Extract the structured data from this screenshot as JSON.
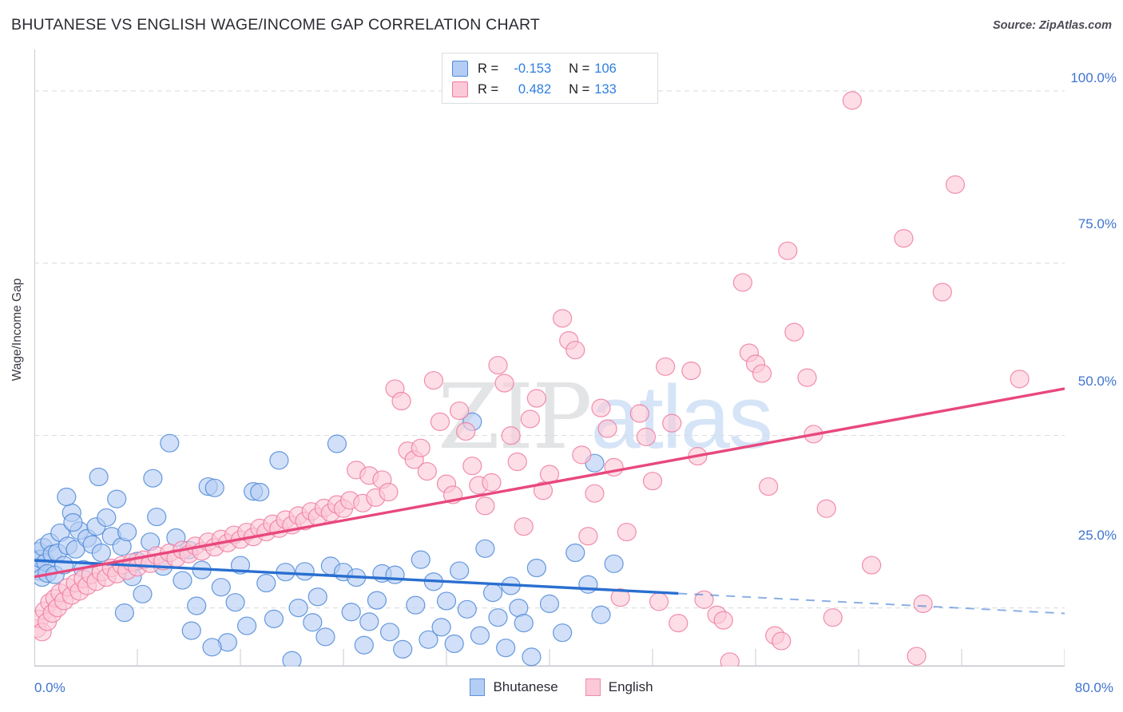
{
  "header": {
    "title": "BHUTANESE VS ENGLISH WAGE/INCOME GAP CORRELATION CHART",
    "source": "Source: ZipAtlas.com"
  },
  "watermark": {
    "part1": "ZIP",
    "part2": "atlas"
  },
  "stats_legend": {
    "rows": [
      {
        "series": "Bhutanese",
        "color": "#b4cdf4",
        "r_label": "R =",
        "r_value": "-0.153",
        "n_label": "N =",
        "n_value": "106"
      },
      {
        "series": "English",
        "color": "#fbc9d8",
        "r_label": "R =",
        "r_value": "0.482",
        "n_label": "N =",
        "n_value": "133"
      }
    ]
  },
  "bottom_legend": {
    "items": [
      {
        "label": "Bhutanese",
        "color": "#b4cdf4"
      },
      {
        "label": "English",
        "color": "#fbc9d8"
      }
    ]
  },
  "chart_data": {
    "type": "scatter",
    "title": "BHUTANESE VS ENGLISH WAGE/INCOME GAP CORRELATION CHART",
    "xlabel": "",
    "ylabel": "Wage/Income Gap",
    "xlim": [
      0,
      80
    ],
    "ylim": [
      16.5,
      106.0
    ],
    "xticks": [
      0,
      80
    ],
    "xticklabels": [
      "0.0%",
      "80.0%"
    ],
    "yticks": [
      25,
      50,
      75,
      100
    ],
    "yticklabels": [
      "25.0%",
      "50.0%",
      "75.0%",
      "100.0%"
    ],
    "grid": "horizontal-dashed",
    "legend_position": "bottom-center",
    "series": [
      {
        "name": "Bhutanese",
        "color": "#b4cdf4",
        "stroke": "#4d88d8",
        "r": -0.153,
        "n": 106,
        "trend": {
          "x0": 0.0,
          "y0": 31.9,
          "x1": 50.0,
          "y1": 27.1,
          "x_solid_end": 50.0,
          "x_dashed_end": 80.0,
          "y_dashed_end": 24.2
        },
        "points": [
          [
            0.2,
            31.0
          ],
          [
            0.3,
            33.2
          ],
          [
            0.4,
            30.3
          ],
          [
            0.5,
            32.1
          ],
          [
            0.6,
            29.4
          ],
          [
            0.7,
            33.8
          ],
          [
            0.9,
            31.6
          ],
          [
            1.0,
            30.0
          ],
          [
            1.2,
            34.5
          ],
          [
            1.4,
            32.8
          ],
          [
            1.6,
            29.8
          ],
          [
            1.8,
            33.0
          ],
          [
            2.0,
            35.9
          ],
          [
            2.3,
            31.2
          ],
          [
            2.6,
            34.0
          ],
          [
            2.9,
            38.8
          ],
          [
            3.2,
            33.5
          ],
          [
            3.5,
            36.2
          ],
          [
            3.8,
            30.6
          ],
          [
            4.1,
            35.1
          ],
          [
            2.5,
            41.1
          ],
          [
            3.0,
            37.4
          ],
          [
            4.5,
            34.2
          ],
          [
            4.8,
            36.8
          ],
          [
            5.2,
            33.0
          ],
          [
            5.6,
            38.1
          ],
          [
            6.0,
            35.4
          ],
          [
            6.4,
            40.8
          ],
          [
            5.0,
            44.0
          ],
          [
            6.8,
            33.9
          ],
          [
            7.2,
            36.0
          ],
          [
            7.6,
            29.5
          ],
          [
            8.0,
            31.8
          ],
          [
            8.4,
            27.0
          ],
          [
            7.0,
            24.3
          ],
          [
            9.0,
            34.6
          ],
          [
            9.5,
            38.2
          ],
          [
            10.0,
            31.0
          ],
          [
            10.5,
            48.9
          ],
          [
            9.2,
            43.8
          ],
          [
            11.0,
            35.2
          ],
          [
            11.5,
            29.0
          ],
          [
            12.0,
            33.4
          ],
          [
            12.6,
            25.3
          ],
          [
            13.0,
            30.5
          ],
          [
            13.5,
            42.6
          ],
          [
            14.0,
            42.4
          ],
          [
            12.2,
            21.7
          ],
          [
            14.5,
            28.0
          ],
          [
            15.0,
            20.0
          ],
          [
            15.6,
            25.8
          ],
          [
            16.0,
            31.2
          ],
          [
            16.5,
            22.4
          ],
          [
            13.8,
            19.3
          ],
          [
            17.0,
            41.9
          ],
          [
            17.5,
            41.8
          ],
          [
            18.0,
            28.6
          ],
          [
            18.6,
            23.4
          ],
          [
            19.0,
            46.4
          ],
          [
            19.5,
            30.2
          ],
          [
            20.0,
            17.4
          ],
          [
            20.5,
            25.0
          ],
          [
            21.0,
            30.3
          ],
          [
            21.6,
            22.9
          ],
          [
            22.0,
            26.6
          ],
          [
            22.6,
            20.8
          ],
          [
            23.0,
            31.1
          ],
          [
            23.5,
            48.8
          ],
          [
            24.0,
            30.2
          ],
          [
            24.6,
            24.4
          ],
          [
            25.0,
            29.4
          ],
          [
            25.6,
            19.6
          ],
          [
            26.0,
            23.0
          ],
          [
            26.6,
            26.1
          ],
          [
            27.0,
            30.0
          ],
          [
            27.6,
            21.5
          ],
          [
            28.0,
            29.8
          ],
          [
            28.6,
            19.0
          ],
          [
            29.0,
            13.8
          ],
          [
            29.6,
            25.4
          ],
          [
            30.0,
            32.0
          ],
          [
            30.6,
            20.4
          ],
          [
            31.0,
            28.8
          ],
          [
            31.6,
            22.2
          ],
          [
            32.0,
            26.0
          ],
          [
            32.6,
            19.8
          ],
          [
            33.0,
            30.4
          ],
          [
            33.6,
            24.8
          ],
          [
            34.0,
            52.0
          ],
          [
            34.6,
            21.0
          ],
          [
            35.0,
            33.6
          ],
          [
            35.6,
            27.2
          ],
          [
            36.0,
            23.6
          ],
          [
            36.6,
            19.2
          ],
          [
            37.0,
            28.2
          ],
          [
            37.6,
            25.0
          ],
          [
            38.0,
            22.8
          ],
          [
            38.6,
            17.9
          ],
          [
            39.0,
            30.8
          ],
          [
            40.0,
            25.6
          ],
          [
            41.0,
            21.4
          ],
          [
            42.0,
            33.0
          ],
          [
            43.0,
            28.4
          ],
          [
            43.5,
            46.0
          ],
          [
            44.0,
            24.0
          ],
          [
            45.0,
            31.4
          ]
        ]
      },
      {
        "name": "English",
        "color": "#fbc9d8",
        "stroke": "#ef7ba0",
        "r": 0.482,
        "n": 133,
        "trend": {
          "x0": 0.0,
          "y0": 29.5,
          "x1": 80.0,
          "y1": 56.8,
          "x_solid_end": 80.0
        },
        "points": [
          [
            0.2,
            22.0
          ],
          [
            0.4,
            23.4
          ],
          [
            0.6,
            21.5
          ],
          [
            0.8,
            24.6
          ],
          [
            1.0,
            23.0
          ],
          [
            1.2,
            25.8
          ],
          [
            1.4,
            24.2
          ],
          [
            1.6,
            26.4
          ],
          [
            1.8,
            25.0
          ],
          [
            2.0,
            27.2
          ],
          [
            2.3,
            26.0
          ],
          [
            2.6,
            28.0
          ],
          [
            2.9,
            26.8
          ],
          [
            3.2,
            28.6
          ],
          [
            3.5,
            27.4
          ],
          [
            3.8,
            29.2
          ],
          [
            4.1,
            28.2
          ],
          [
            4.4,
            29.8
          ],
          [
            4.8,
            28.8
          ],
          [
            5.2,
            30.2
          ],
          [
            5.6,
            29.4
          ],
          [
            6.0,
            30.8
          ],
          [
            6.4,
            29.9
          ],
          [
            6.8,
            31.2
          ],
          [
            7.2,
            30.4
          ],
          [
            7.6,
            31.6
          ],
          [
            8.0,
            30.9
          ],
          [
            8.5,
            32.0
          ],
          [
            9.0,
            31.4
          ],
          [
            9.5,
            32.6
          ],
          [
            10.0,
            31.8
          ],
          [
            10.5,
            33.0
          ],
          [
            11.0,
            32.2
          ],
          [
            11.5,
            33.4
          ],
          [
            12.0,
            32.8
          ],
          [
            12.5,
            34.0
          ],
          [
            13.0,
            33.2
          ],
          [
            13.5,
            34.6
          ],
          [
            14.0,
            33.8
          ],
          [
            14.5,
            35.0
          ],
          [
            15.0,
            34.4
          ],
          [
            15.5,
            35.6
          ],
          [
            16.0,
            34.9
          ],
          [
            16.5,
            36.0
          ],
          [
            17.0,
            35.3
          ],
          [
            17.5,
            36.6
          ],
          [
            18.0,
            36.0
          ],
          [
            18.5,
            37.2
          ],
          [
            19.0,
            36.5
          ],
          [
            19.5,
            37.8
          ],
          [
            20.0,
            37.0
          ],
          [
            20.5,
            38.4
          ],
          [
            21.0,
            37.6
          ],
          [
            21.5,
            39.0
          ],
          [
            22.0,
            38.2
          ],
          [
            22.5,
            39.5
          ],
          [
            23.0,
            38.8
          ],
          [
            23.5,
            40.0
          ],
          [
            24.0,
            39.4
          ],
          [
            24.5,
            40.6
          ],
          [
            25.0,
            45.0
          ],
          [
            25.5,
            40.2
          ],
          [
            26.0,
            44.2
          ],
          [
            26.5,
            41.0
          ],
          [
            27.0,
            43.6
          ],
          [
            27.5,
            41.8
          ],
          [
            28.0,
            56.8
          ],
          [
            28.5,
            55.0
          ],
          [
            29.0,
            47.8
          ],
          [
            29.5,
            46.5
          ],
          [
            30.0,
            48.2
          ],
          [
            30.5,
            44.8
          ],
          [
            31.0,
            58.0
          ],
          [
            31.5,
            52.0
          ],
          [
            32.0,
            43.0
          ],
          [
            32.5,
            41.4
          ],
          [
            33.0,
            53.6
          ],
          [
            33.5,
            50.6
          ],
          [
            34.0,
            45.6
          ],
          [
            34.5,
            42.8
          ],
          [
            35.0,
            39.8
          ],
          [
            35.5,
            43.2
          ],
          [
            36.0,
            60.2
          ],
          [
            36.5,
            57.6
          ],
          [
            37.0,
            50.0
          ],
          [
            37.5,
            46.2
          ],
          [
            38.0,
            36.8
          ],
          [
            38.5,
            52.4
          ],
          [
            39.0,
            55.4
          ],
          [
            39.5,
            42.0
          ],
          [
            40.0,
            44.4
          ],
          [
            41.0,
            67.0
          ],
          [
            41.5,
            63.8
          ],
          [
            42.0,
            62.4
          ],
          [
            42.5,
            47.2
          ],
          [
            43.0,
            35.4
          ],
          [
            43.5,
            41.6
          ],
          [
            44.0,
            54.0
          ],
          [
            44.5,
            51.0
          ],
          [
            45.0,
            45.4
          ],
          [
            45.5,
            26.5
          ],
          [
            46.0,
            36.0
          ],
          [
            47.0,
            53.2
          ],
          [
            47.5,
            49.8
          ],
          [
            48.0,
            43.4
          ],
          [
            48.5,
            25.9
          ],
          [
            49.0,
            60.0
          ],
          [
            49.5,
            51.8
          ],
          [
            50.0,
            22.8
          ],
          [
            51.0,
            59.4
          ],
          [
            51.5,
            47.0
          ],
          [
            52.0,
            26.2
          ],
          [
            53.0,
            24.0
          ],
          [
            53.5,
            23.2
          ],
          [
            54.0,
            17.2
          ],
          [
            55.0,
            72.2
          ],
          [
            55.5,
            62.0
          ],
          [
            56.0,
            60.4
          ],
          [
            56.5,
            59.0
          ],
          [
            57.0,
            42.6
          ],
          [
            57.5,
            21.0
          ],
          [
            58.0,
            20.2
          ],
          [
            58.5,
            76.8
          ],
          [
            59.0,
            65.0
          ],
          [
            60.0,
            58.4
          ],
          [
            60.5,
            50.2
          ],
          [
            61.5,
            39.4
          ],
          [
            62.0,
            23.6
          ],
          [
            63.5,
            98.6
          ],
          [
            65.0,
            31.2
          ],
          [
            67.5,
            78.6
          ],
          [
            68.5,
            18.0
          ],
          [
            69.0,
            25.6
          ],
          [
            70.5,
            70.8
          ],
          [
            71.5,
            86.4
          ],
          [
            76.5,
            58.2
          ]
        ]
      }
    ]
  },
  "axes": {
    "ylabel": "Wage/Income Gap",
    "yticklabels": [
      "100.0%",
      "75.0%",
      "50.0%",
      "25.0%"
    ],
    "xticklabels": {
      "left": "0.0%",
      "right": "80.0%"
    }
  }
}
